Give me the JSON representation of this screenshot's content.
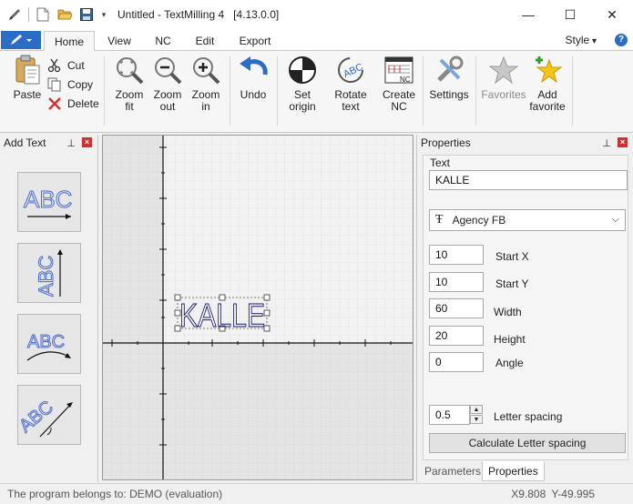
{
  "window": {
    "title": "Untitled - TextMilling 4   [4.13.0.0]",
    "minimize": "—",
    "maximize": "☐",
    "close": "✕"
  },
  "tabs": [
    "Home",
    "View",
    "NC",
    "Edit",
    "Export"
  ],
  "active_tab": "Home",
  "style_label": "Style",
  "help_label": "?",
  "ribbon": {
    "paste": "Paste",
    "cut": "Cut",
    "copy": "Copy",
    "delete": "Delete",
    "zoom_fit": [
      "Zoom",
      "fit"
    ],
    "zoom_out": [
      "Zoom",
      "out"
    ],
    "zoom_in": [
      "Zoom",
      "in"
    ],
    "undo": "Undo",
    "set_origin": [
      "Set",
      "origin"
    ],
    "rotate_text": [
      "Rotate",
      "text"
    ],
    "create_nc": [
      "Create",
      "NC"
    ],
    "settings": "Settings",
    "favorites": "Favorites",
    "add_favorite": [
      "Add",
      "favorite"
    ]
  },
  "add_text_panel": {
    "title": "Add Text",
    "tiles": [
      "horizontal-text",
      "vertical-text",
      "arc-text",
      "angled-text"
    ],
    "tile_text": "ABC"
  },
  "canvas": {
    "text": "KALLE",
    "text_color": "#1a1a6e"
  },
  "properties": {
    "title": "Properties",
    "text_label": "Text",
    "text_value": "KALLE",
    "font": "Agency FB",
    "start_x_value": "10",
    "start_x_label": "Start X",
    "start_y_value": "10",
    "start_y_label": "Start Y",
    "width_value": "60",
    "width_label": "Width",
    "height_value": "20",
    "height_label": "Height",
    "angle_value": "0",
    "angle_label": "Angle",
    "letter_spacing_value": "0.5",
    "letter_spacing_label": "Letter spacing",
    "calc_button": "Calculate Letter spacing",
    "bottom_tabs": [
      "Parameters",
      "Properties"
    ]
  },
  "status": {
    "owner": "The program belongs to: DEMO (evaluation)",
    "coords": "X9.808 Y-49.995"
  },
  "colors": {
    "accent": "#2b6cc4",
    "close_red": "#d32f2f"
  }
}
